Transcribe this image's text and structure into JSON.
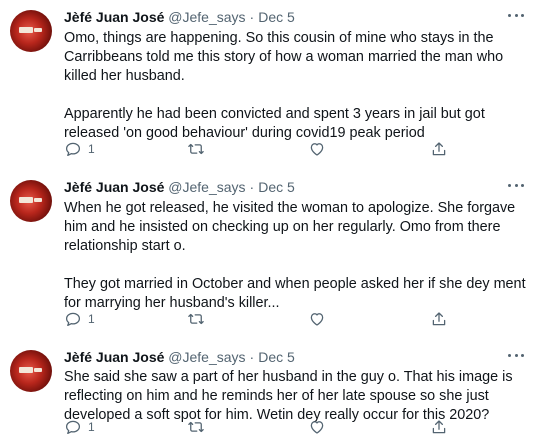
{
  "tweets": [
    {
      "name": "Jèfé Juan José",
      "handle": "@Jefe_says",
      "separator": "·",
      "date": "Dec 5",
      "paragraphs": [
        "Omo, things are happening. So this cousin of mine who stays in the Carribbeans told me this story of how a woman married the man who killed her husband.",
        "Apparently he had been convicted and spent 3 years in jail but got released 'on good behaviour' during covid19 peak period"
      ],
      "reply_count": "1"
    },
    {
      "name": "Jèfé Juan José",
      "handle": "@Jefe_says",
      "separator": "·",
      "date": "Dec 5",
      "paragraphs": [
        "When he got released, he visited the woman to apologize. She forgave him and he insisted on checking up on her regularly. Omo from there relationship start o.",
        "They got married in October and when people asked her if she dey ment for marrying her husband's killer..."
      ],
      "reply_count": "1"
    },
    {
      "name": "Jèfé Juan José",
      "handle": "@Jefe_says",
      "separator": "·",
      "date": "Dec 5",
      "paragraphs": [
        "She said she saw a part of her husband in the guy o. That his image is reflecting on him and he reminds her of her late spouse so she just developed a soft spot for him. Wetin dey really occur for this 2020?"
      ],
      "reply_count": "1"
    }
  ],
  "icons": {
    "more": "more-dots-icon",
    "reply": "reply-icon",
    "retweet": "retweet-icon",
    "like": "heart-icon",
    "share": "share-icon"
  },
  "colors": {
    "text": "#0f1419",
    "secondary": "#536471"
  }
}
